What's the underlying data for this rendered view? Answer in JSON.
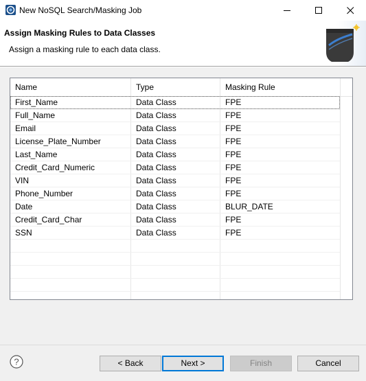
{
  "window": {
    "title": "New NoSQL Search/Masking Job",
    "icon": "app-logo-icon"
  },
  "banner": {
    "title": "Assign Masking Rules to Data Classes",
    "description": "Assign a masking rule to each data class."
  },
  "table": {
    "columns": [
      "Name",
      "Type",
      "Masking Rule"
    ],
    "rows": [
      {
        "name": "First_Name",
        "type": "Data Class",
        "rule": "FPE"
      },
      {
        "name": "Full_Name",
        "type": "Data Class",
        "rule": "FPE"
      },
      {
        "name": "Email",
        "type": "Data Class",
        "rule": "FPE"
      },
      {
        "name": "License_Plate_Number",
        "type": "Data Class",
        "rule": "FPE"
      },
      {
        "name": "Last_Name",
        "type": "Data Class",
        "rule": "FPE"
      },
      {
        "name": "Credit_Card_Numeric",
        "type": "Data Class",
        "rule": "FPE"
      },
      {
        "name": "VIN",
        "type": "Data Class",
        "rule": "FPE"
      },
      {
        "name": "Phone_Number",
        "type": "Data Class",
        "rule": "FPE"
      },
      {
        "name": "Date",
        "type": "Data Class",
        "rule": "BLUR_DATE"
      },
      {
        "name": "Credit_Card_Char",
        "type": "Data Class",
        "rule": "FPE"
      },
      {
        "name": "SSN",
        "type": "Data Class",
        "rule": "FPE"
      }
    ]
  },
  "buttons": {
    "back": "< Back",
    "next": "Next >",
    "finish": "Finish",
    "cancel": "Cancel"
  },
  "icons": {
    "help": "help-icon",
    "minimize": "minimize-icon",
    "maximize": "maximize-icon",
    "close": "close-icon",
    "banner": "wizard-banner-icon"
  },
  "colors": {
    "accent": "#0078d7"
  }
}
